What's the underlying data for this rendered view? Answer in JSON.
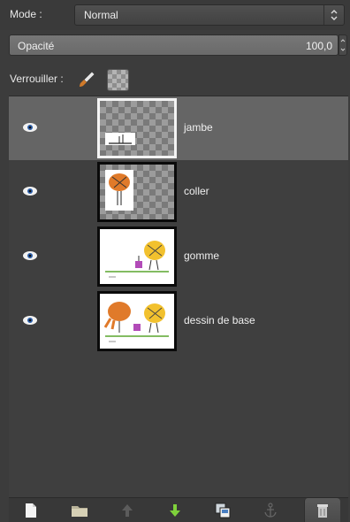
{
  "mode": {
    "label": "Mode :",
    "value": "Normal"
  },
  "opacity": {
    "label": "Opacité",
    "value": "100,0"
  },
  "lock": {
    "label": "Verrouiller :"
  },
  "layers": [
    {
      "name": "jambe",
      "selected": true,
      "visible": true
    },
    {
      "name": "coller",
      "selected": false,
      "visible": true
    },
    {
      "name": "gomme",
      "selected": false,
      "visible": true
    },
    {
      "name": "dessin de base",
      "selected": false,
      "visible": true
    }
  ],
  "toolbar": {
    "icons": [
      "new-layer-icon",
      "new-layer-group-icon",
      "raise-layer-icon",
      "lower-layer-icon",
      "duplicate-layer-icon",
      "anchor-layer-icon",
      "delete-layer-icon"
    ]
  },
  "colors": {
    "selected_row": "#656565",
    "lower_arrow": "#7fd13b",
    "panel_bg": "#3f3f3f"
  }
}
